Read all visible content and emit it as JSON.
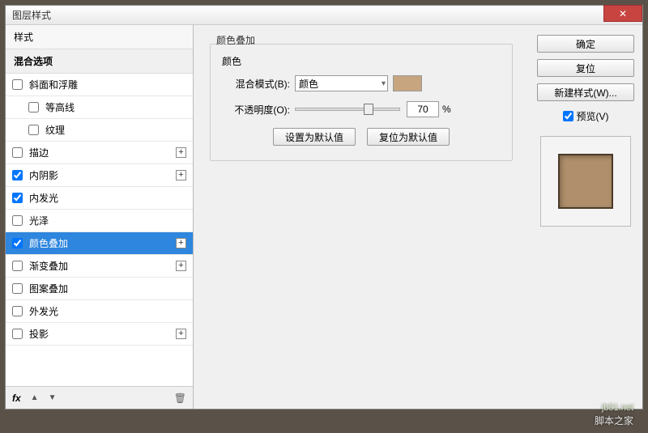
{
  "window": {
    "title": "图层样式"
  },
  "left": {
    "styles_header": "样式",
    "blend_header": "混合选项",
    "items": [
      {
        "label": "斜面和浮雕",
        "checked": false,
        "plus": false,
        "indent": false
      },
      {
        "label": "等高线",
        "checked": false,
        "plus": false,
        "indent": true
      },
      {
        "label": "纹理",
        "checked": false,
        "plus": false,
        "indent": true
      },
      {
        "label": "描边",
        "checked": false,
        "plus": true,
        "indent": false
      },
      {
        "label": "内阴影",
        "checked": true,
        "plus": true,
        "indent": false
      },
      {
        "label": "内发光",
        "checked": true,
        "plus": false,
        "indent": false
      },
      {
        "label": "光泽",
        "checked": false,
        "plus": false,
        "indent": false
      },
      {
        "label": "颜色叠加",
        "checked": true,
        "plus": true,
        "indent": false,
        "selected": true
      },
      {
        "label": "渐变叠加",
        "checked": false,
        "plus": true,
        "indent": false
      },
      {
        "label": "图案叠加",
        "checked": false,
        "plus": false,
        "indent": false
      },
      {
        "label": "外发光",
        "checked": false,
        "plus": false,
        "indent": false
      },
      {
        "label": "投影",
        "checked": false,
        "plus": true,
        "indent": false
      }
    ],
    "footer_fx": "fx"
  },
  "center": {
    "section_title": "颜色叠加",
    "color_group": "颜色",
    "blend_mode_label": "混合模式(B):",
    "blend_mode_value": "颜色",
    "overlay_color": "#c6a57f",
    "opacity_label": "不透明度(O):",
    "opacity_value": "70",
    "opacity_unit": "%",
    "btn_default": "设置为默认值",
    "btn_reset": "复位为默认值"
  },
  "right": {
    "ok": "确定",
    "cancel": "复位",
    "new_style": "新建样式(W)...",
    "preview_label": "预览(V)",
    "preview_checked": true
  },
  "watermark": {
    "line1": "jb51.net",
    "line2": "脚本之家"
  }
}
